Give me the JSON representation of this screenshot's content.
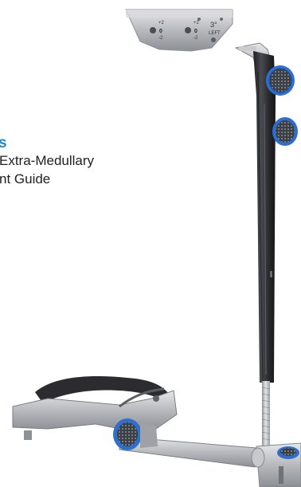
{
  "caption": {
    "brand": "s",
    "line1": "Extra-Medullary",
    "line2": "nt Guide"
  },
  "plate": {
    "mark_a_top": "+2",
    "mark_a_mid": "0",
    "mark_a_bot": "-2",
    "mark_b_top": "+2",
    "mark_b_mid": "0",
    "mark_b_bot": "-2",
    "angle_label": "3°",
    "side_label": "LEFT"
  },
  "colors": {
    "brand_blue": "#1e88c8",
    "knob_blue": "#2c6fd1",
    "rod_dark": "#2b2b2f",
    "steel": "#b9bcc1"
  }
}
